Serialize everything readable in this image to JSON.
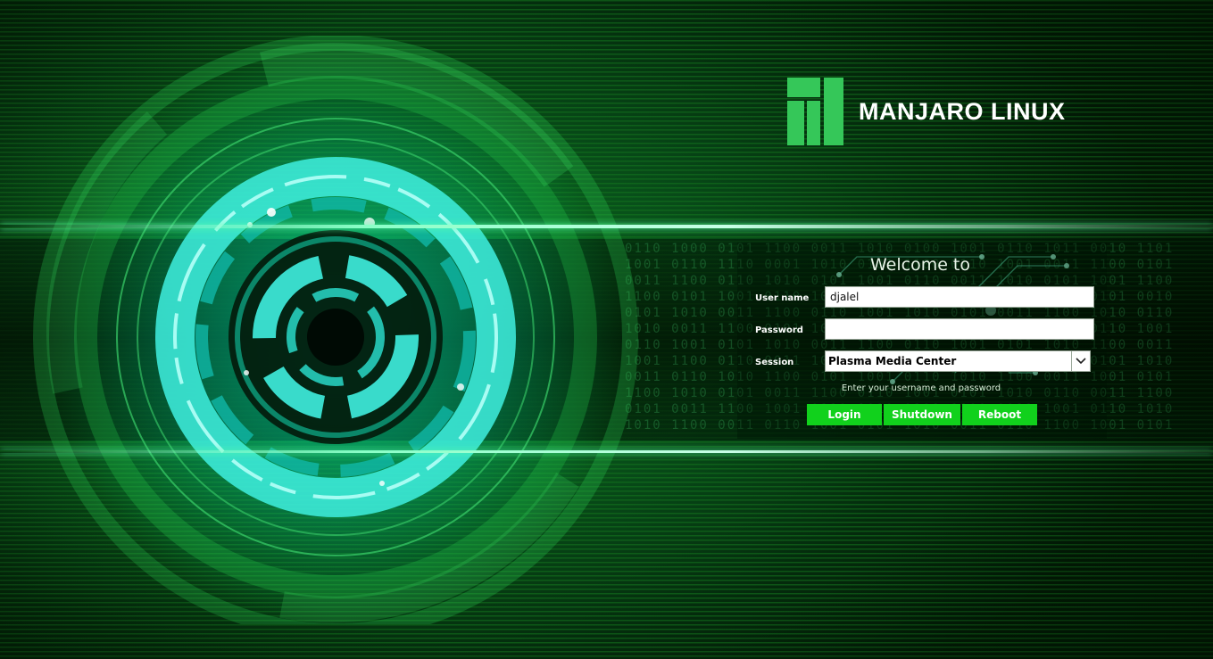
{
  "brand": {
    "logo_text": "MANJARO LINUX",
    "accent_color": "#35c759",
    "button_color": "#11d11c"
  },
  "login": {
    "welcome_text": "Welcome to",
    "username_label": "User name",
    "username_value": "djalel",
    "password_label": "Password",
    "password_value": "",
    "session_label": "Session",
    "session_value": "Plasma Media Center",
    "hint_text": "Enter your username and password"
  },
  "buttons": {
    "login": "Login",
    "shutdown": "Shutdown",
    "reboot": "Reboot"
  },
  "icons": {
    "logo": "manjaro-logo-icon",
    "session_dropdown": "chevron-down-icon"
  }
}
